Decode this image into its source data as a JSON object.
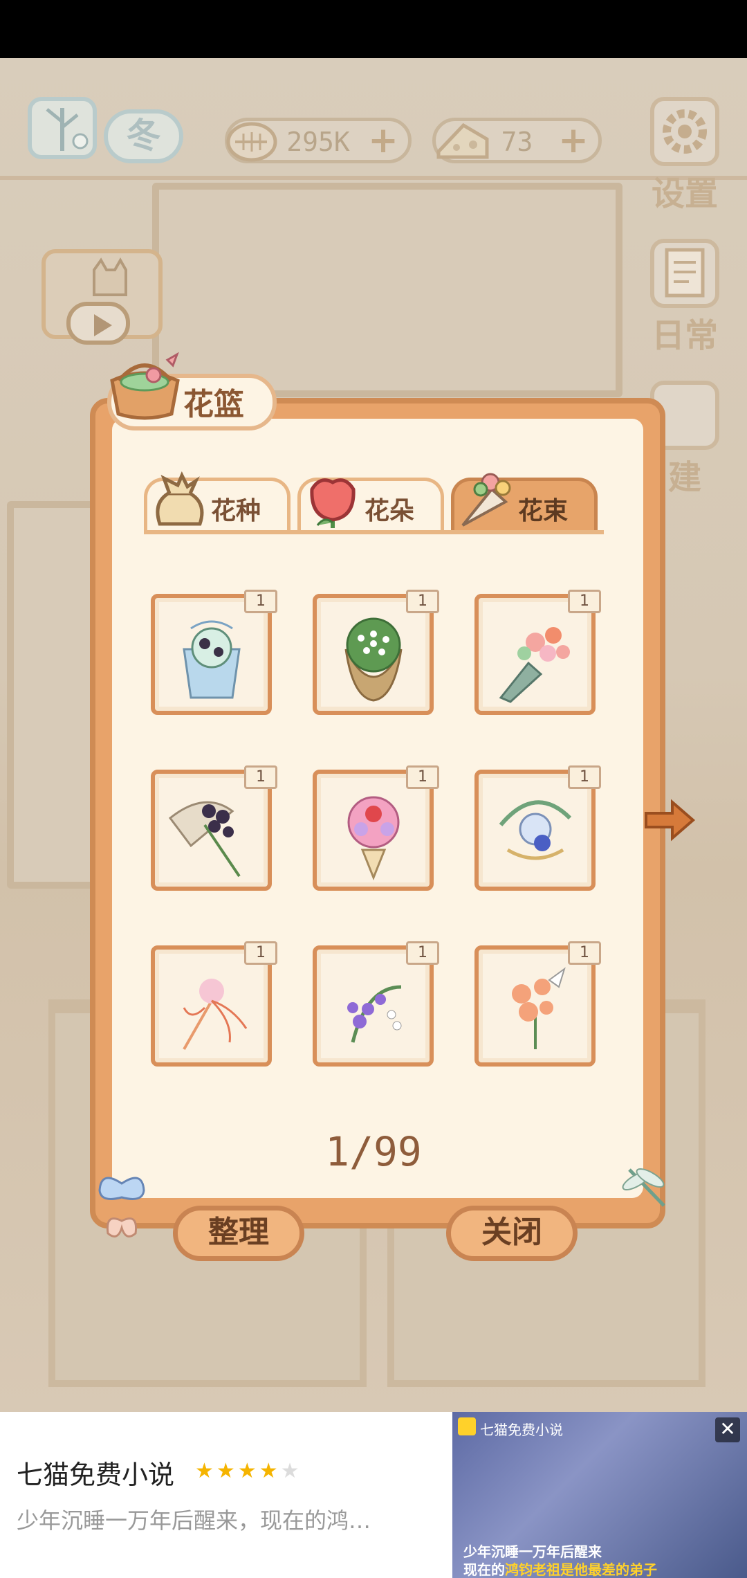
{
  "hud": {
    "season_label": "冬",
    "currency_fish": "295K",
    "currency_cheese": "73",
    "plus_symbol": "+",
    "settings_label": "设置",
    "daily_label": "日常",
    "build_label": "建"
  },
  "dialog": {
    "title": "花篮",
    "tabs": [
      {
        "label": "花种",
        "icon": "seed-bag-icon",
        "active": false
      },
      {
        "label": "花朵",
        "icon": "rose-icon",
        "active": false
      },
      {
        "label": "花束",
        "icon": "bouquet-icon",
        "active": true
      }
    ],
    "items": [
      {
        "count": "1",
        "art": "blue-wrapped-bouquet"
      },
      {
        "count": "1",
        "art": "green-white-bouquet"
      },
      {
        "count": "1",
        "art": "pink-orange-bouquet"
      },
      {
        "count": "1",
        "art": "blackberry-bouquet"
      },
      {
        "count": "1",
        "art": "pink-rose-cone-bouquet"
      },
      {
        "count": "1",
        "art": "blue-wreath-bouquet"
      },
      {
        "count": "1",
        "art": "spider-lily-bouquet"
      },
      {
        "count": "1",
        "art": "purple-berry-bouquet"
      },
      {
        "count": "1",
        "art": "peach-flower-bouquet"
      }
    ],
    "page": "1/99",
    "sort_button": "整理",
    "close_button": "关闭"
  },
  "ad": {
    "app_name": "七猫免费小说",
    "rating": 4,
    "description": "少年沉睡一万年后醒来，现在的鸿…",
    "thumb_brand": "七猫免费小说",
    "thumb_caption_1": "少年沉睡一万年后醒来",
    "thumb_caption_2_pre": "现在的",
    "thumb_caption_2_hl": "鸿钧老祖是他最差的弟子",
    "close": "✕"
  },
  "colors": {
    "dialog_frame": "#e8a36a",
    "dialog_panel": "#fdf4e4",
    "text_brown": "#8b5732",
    "star_on": "#f5b400"
  }
}
